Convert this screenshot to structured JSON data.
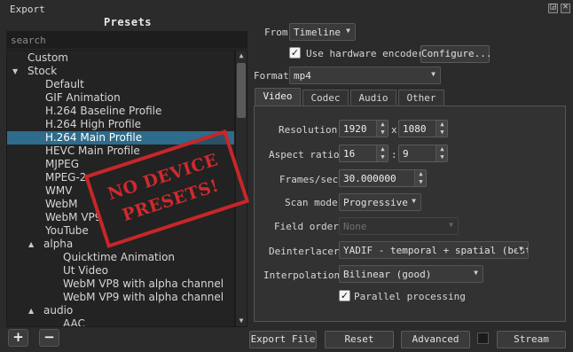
{
  "window": {
    "title": "Export"
  },
  "presets": {
    "title": "Presets",
    "search_placeholder": "search",
    "items": [
      {
        "label": "Custom",
        "level": 1,
        "arrow": ""
      },
      {
        "label": "Stock",
        "level": 0,
        "arrow": "▼"
      },
      {
        "label": "Default",
        "level": 2,
        "arrow": ""
      },
      {
        "label": "GIF Animation",
        "level": 2,
        "arrow": ""
      },
      {
        "label": "H.264 Baseline Profile",
        "level": 2,
        "arrow": ""
      },
      {
        "label": "H.264 High Profile",
        "level": 2,
        "arrow": ""
      },
      {
        "label": "H.264 Main Profile",
        "level": 2,
        "arrow": "",
        "selected": true
      },
      {
        "label": "HEVC Main Profile",
        "level": 2,
        "arrow": ""
      },
      {
        "label": "MJPEG",
        "level": 2,
        "arrow": ""
      },
      {
        "label": "MPEG-2",
        "level": 2,
        "arrow": ""
      },
      {
        "label": "WMV",
        "level": 2,
        "arrow": ""
      },
      {
        "label": "WebM",
        "level": 2,
        "arrow": ""
      },
      {
        "label": "WebM VP9",
        "level": 2,
        "arrow": ""
      },
      {
        "label": "YouTube",
        "level": 2,
        "arrow": ""
      },
      {
        "label": "alpha",
        "level": 1,
        "arrow": "▲"
      },
      {
        "label": "Quicktime Animation",
        "level": 3,
        "arrow": ""
      },
      {
        "label": "Ut Video",
        "level": 3,
        "arrow": ""
      },
      {
        "label": "WebM VP8 with alpha channel",
        "level": 3,
        "arrow": ""
      },
      {
        "label": "WebM VP9 with alpha channel",
        "level": 3,
        "arrow": ""
      },
      {
        "label": "audio",
        "level": 1,
        "arrow": "▲"
      },
      {
        "label": "AAC",
        "level": 3,
        "arrow": ""
      }
    ],
    "add_label": "+",
    "remove_label": "−",
    "stamp_text_1": "NO DEVICE",
    "stamp_text_2": "PRESETS!"
  },
  "export": {
    "from_label": "From",
    "from_value": "Timeline",
    "hw_encoder_label": "Use hardware encoder",
    "hw_encoder_checked": true,
    "configure_label": "Configure...",
    "format_label": "Format",
    "format_value": "mp4",
    "tabs": [
      "Video",
      "Codec",
      "Audio",
      "Other"
    ],
    "active_tab": "Video",
    "video": {
      "resolution_label": "Resolution",
      "width": "1920",
      "height": "1080",
      "x_sep": "x",
      "aspect_label": "Aspect ratio",
      "aspect_w": "16",
      "aspect_h": "9",
      "colon_sep": ":",
      "fps_label": "Frames/sec",
      "fps": "30.000000",
      "scan_label": "Scan mode",
      "scan_value": "Progressive",
      "field_label": "Field order",
      "field_value": "None",
      "deint_label": "Deinterlacer",
      "deint_value": "YADIF - temporal + spatial (best)",
      "interp_label": "Interpolation",
      "interp_value": "Bilinear (good)",
      "parallel_label": "Parallel processing",
      "parallel_checked": true
    },
    "buttons": {
      "export_file": "Export File",
      "reset": "Reset",
      "advanced": "Advanced",
      "stream": "Stream"
    }
  },
  "icons": {
    "float": "float-icon",
    "close": "close-icon"
  },
  "colors": {
    "background": "#2b2b2b",
    "selection": "#2f6b8a",
    "stamp": "#c8262a"
  }
}
